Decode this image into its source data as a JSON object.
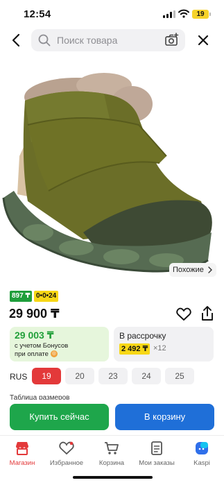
{
  "status_bar": {
    "time": "12:54",
    "battery": "19"
  },
  "search": {
    "placeholder": "Поиск товара"
  },
  "product": {
    "similar_label": "Похожие",
    "badge_green": "897 ₸",
    "badge_yellow": "0•0•24",
    "price": "29 900 ₸"
  },
  "bonus_card": {
    "price": "29 003 ₸",
    "note_line1": "с учетом Бонусов",
    "note_line2": "при оплате"
  },
  "installment_card": {
    "title": "В рассрочку",
    "amount": "2 492 ₸",
    "months": "×12"
  },
  "sizes": {
    "label": "RUS",
    "selected_index": 0,
    "options": [
      "19",
      "20",
      "23",
      "24",
      "25"
    ]
  },
  "size_table_label": "Таблица размеров",
  "actions": {
    "buy_now": "Купить сейчас",
    "add_to_cart": "В корзину"
  },
  "bottom_nav": {
    "items": [
      {
        "label": "Магазин",
        "icon": "store-icon",
        "active": true
      },
      {
        "label": "Избранное",
        "icon": "heart-icon",
        "active": false
      },
      {
        "label": "Корзина",
        "icon": "cart-icon",
        "active": false
      },
      {
        "label": "Мои заказы",
        "icon": "orders-icon",
        "active": false
      },
      {
        "label": "Kaspi",
        "icon": "kaspi-icon",
        "active": false
      }
    ]
  },
  "colors": {
    "accent_red": "#e3393a",
    "buy_green": "#1ea64b",
    "cart_blue": "#1f6fd8",
    "bonus_green": "#22a03a",
    "badge_yellow": "#f7d716"
  }
}
